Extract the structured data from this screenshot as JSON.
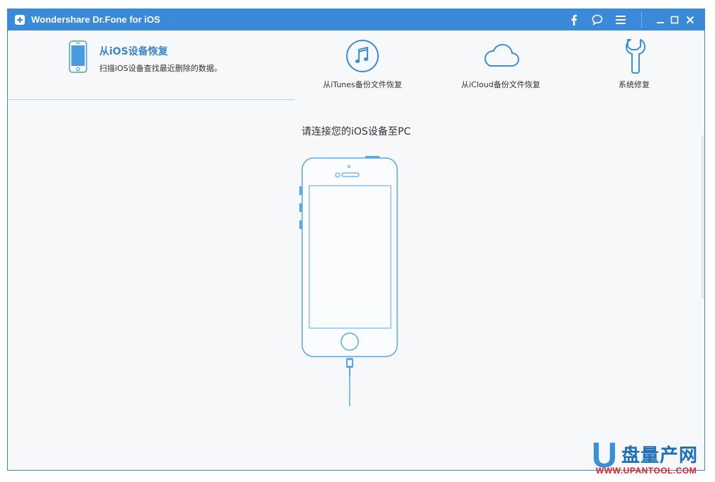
{
  "window": {
    "title": "Wondershare Dr.Fone for iOS",
    "accent_color": "#3b8ad9",
    "toolbar_icons": [
      "facebook-icon",
      "feedback-icon",
      "menu-icon"
    ],
    "window_controls": [
      "minimize-icon",
      "maximize-icon",
      "close-icon"
    ]
  },
  "tabs": {
    "current": {
      "icon": "phone-icon",
      "title": "从iOS设备恢复",
      "description": "扫描iOS设备查找最近删除的数据。"
    },
    "items": [
      {
        "icon": "itunes-music-icon",
        "label": "从iTunes备份文件恢复"
      },
      {
        "icon": "cloud-icon",
        "label": "从iCloud备份文件恢复"
      },
      {
        "icon": "wrench-icon",
        "label": "系统修复"
      }
    ]
  },
  "main": {
    "prompt": "请连接您的iOS设备至PC",
    "illustration": "iphone-with-cable-icon"
  },
  "watermark": {
    "logo_letter": "U",
    "chinese": "盘量产网",
    "english": "WWW.UPANTOOL.COM"
  }
}
